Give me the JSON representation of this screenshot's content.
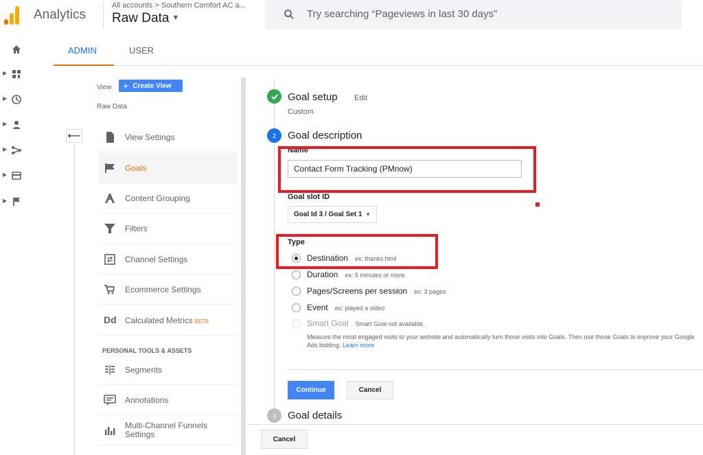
{
  "header": {
    "app_name": "Analytics",
    "breadcrumb": "All accounts > Southern Comfort AC a...",
    "view_name": "Raw Data",
    "search_placeholder": "Try searching “Pageviews in last 30 days”"
  },
  "tabs": [
    {
      "label": "ADMIN",
      "active": true
    },
    {
      "label": "USER",
      "active": false
    }
  ],
  "left_nav": {
    "icons": [
      "home-icon",
      "dashboard-icon",
      "clock-icon",
      "person-icon",
      "acquisition-icon",
      "behavior-icon",
      "flag-icon"
    ]
  },
  "admin_panel": {
    "view_label": "View",
    "create_view_label": "Create View",
    "view_name": "Raw Data",
    "items": [
      {
        "label": "View Settings",
        "icon": "document-icon",
        "active": false
      },
      {
        "label": "Goals",
        "icon": "flag-icon",
        "active": true
      },
      {
        "label": "Content Grouping",
        "icon": "content-grouping-icon",
        "active": false
      },
      {
        "label": "Filters",
        "icon": "filter-icon",
        "active": false
      },
      {
        "label": "Channel Settings",
        "icon": "channel-icon",
        "active": false
      },
      {
        "label": "Ecommerce Settings",
        "icon": "cart-icon",
        "active": false
      },
      {
        "label": "Calculated Metrics",
        "icon": "dd-icon",
        "badge": "BETA",
        "active": false
      }
    ],
    "section_title": "PERSONAL TOOLS & ASSETS",
    "tools": [
      {
        "label": "Segments",
        "icon": "segments-icon"
      },
      {
        "label": "Annotations",
        "icon": "annotations-icon"
      },
      {
        "label": "Multi-Channel Funnels Settings",
        "icon": "funnels-icon"
      }
    ]
  },
  "goal": {
    "step1": {
      "title": "Goal setup",
      "edit": "Edit",
      "sub": "Custom"
    },
    "step2": {
      "number": "2",
      "title": "Goal description"
    },
    "name_label": "Name",
    "name_value": "Contact Form Tracking (PMnow)",
    "slot_label": "Goal slot ID",
    "slot_value": "Goal Id 3 / Goal Set 1",
    "type_label": "Type",
    "types": [
      {
        "label": "Destination",
        "example": "ex: thanks.html",
        "checked": true
      },
      {
        "label": "Duration",
        "example": "ex: 5 minutes or more",
        "checked": false
      },
      {
        "label": "Pages/Screens per session",
        "example": "ex: 3 pages",
        "checked": false
      },
      {
        "label": "Event",
        "example": "ex: played a video",
        "checked": false
      },
      {
        "label": "Smart Goal",
        "example": "Smart Goal not available.",
        "checked": false,
        "disabled": true
      }
    ],
    "smart_desc": "Measure the most engaged visits to your website and automatically turn those visits into Goals. Then use those Goals to improve your Google Ads bidding.",
    "learn_more": "Learn more",
    "continue_label": "Continue",
    "cancel_label": "Cancel",
    "step3": {
      "number": "3",
      "title": "Goal details"
    },
    "bottom_cancel_label": "Cancel"
  },
  "colors": {
    "accent": "#1a73e8",
    "active_orange": "#e8710a",
    "button_blue": "#4285f4",
    "annotation_red": "#e51c23",
    "check_green": "#34a853"
  }
}
